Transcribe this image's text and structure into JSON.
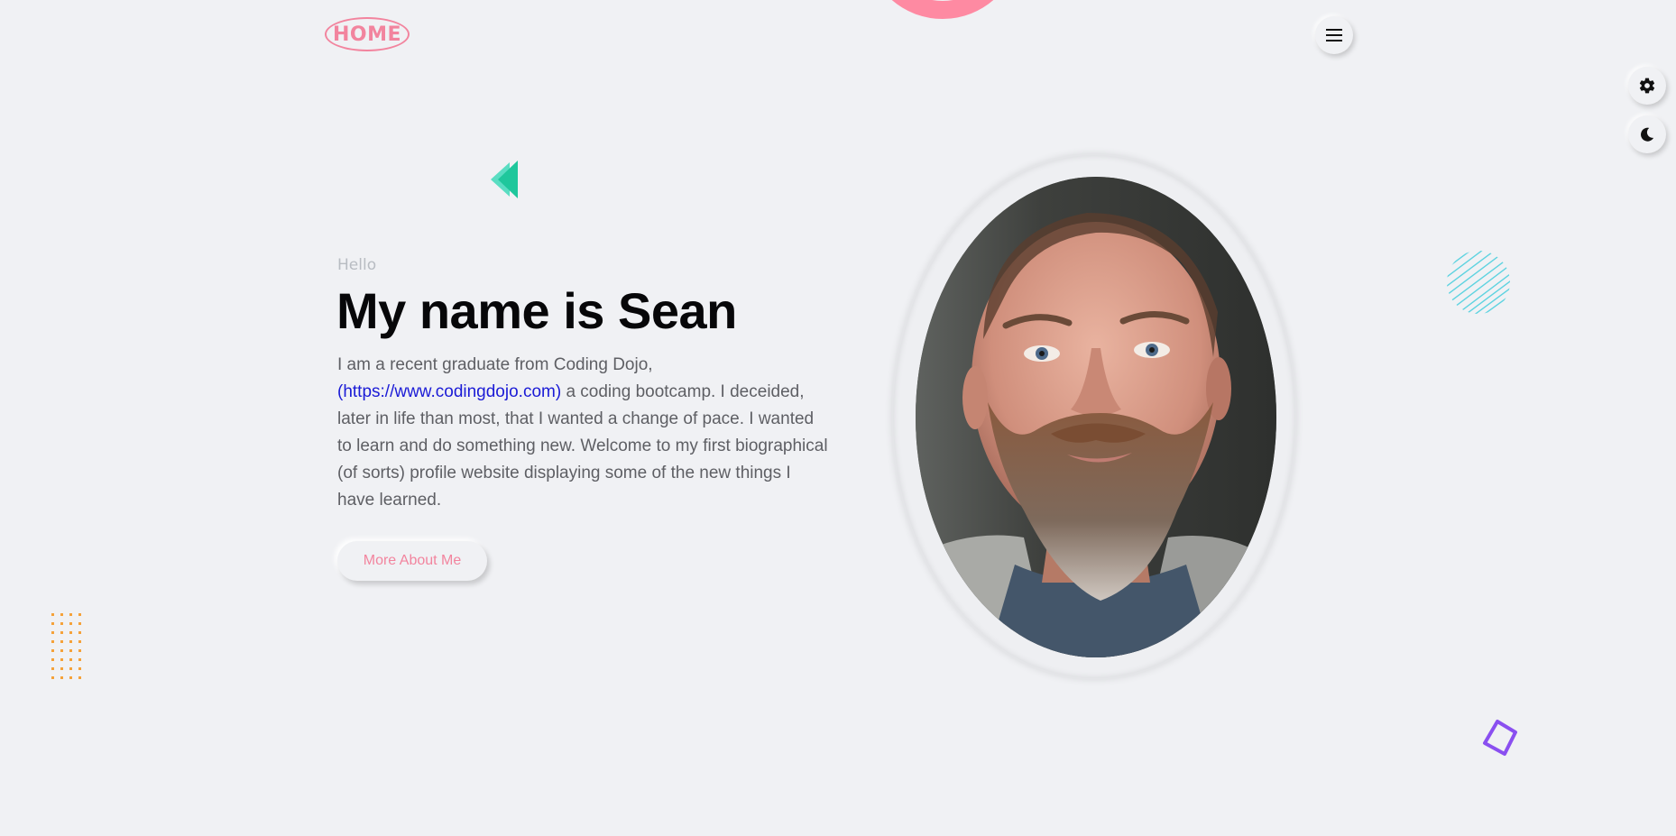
{
  "nav": {
    "logo": "HOME"
  },
  "hero": {
    "greeting": "Hello",
    "title": "My name is Sean",
    "bio_before": "I am a recent graduate from Coding Dojo, ",
    "bio_link": "(https://www.codingdojo.com)",
    "bio_after": " a coding bootcamp. I deceided, later in life than most, that I wanted a change of pace. I wanted to learn and do something new. Welcome to my first biographical (of sorts) profile website displaying some of the new things I have learned.",
    "button": "More About Me"
  },
  "colors": {
    "background": "#f0f1f4",
    "accent_pink": "#f2849e",
    "link_blue": "#1b1bd6",
    "teal": "#23c9a4",
    "cyan": "#5ed3e0",
    "orange": "#f5a23a",
    "purple": "#8a4ff0"
  },
  "icons": {
    "menu": "hamburger-menu-icon",
    "settings": "gear-icon",
    "theme": "moon-icon"
  }
}
